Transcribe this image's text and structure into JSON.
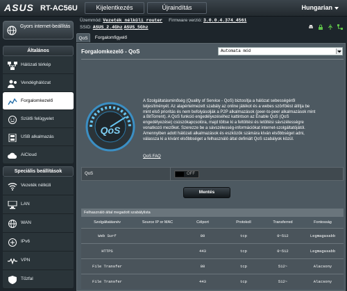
{
  "header": {
    "logo": "ASUS",
    "model": "RT-AC56U",
    "logout_label": "Kijelentkezés",
    "reboot_label": "Újraindítás",
    "language": "Hungarian"
  },
  "status": {
    "mode_label": "Üzemmód:",
    "mode_value": "Vezeték nélküli router",
    "firmware_label": "Firmware verzió:",
    "firmware_value": "3.0.0.4.374_4561",
    "ssid_label": "SSID:",
    "ssid_24": "ASUS_2.4Ghz",
    "ssid_5": "ASUS_5Ghz"
  },
  "sidebar": {
    "quick_label": "Gyors internet-beállítás",
    "general_title": "Általános",
    "general_items": [
      {
        "label": "Hálózati térkép",
        "icon": "network-map-icon"
      },
      {
        "label": "Vendéghálózat",
        "icon": "guest-network-icon"
      },
      {
        "label": "Forgalomkezelő",
        "icon": "traffic-manager-icon"
      },
      {
        "label": "Szülői felügyelet",
        "icon": "parental-control-icon"
      },
      {
        "label": "USB alkalmazás",
        "icon": "usb-icon"
      },
      {
        "label": "AiCloud",
        "icon": "cloud-icon"
      }
    ],
    "advanced_title": "Speciális beállítások",
    "advanced_items": [
      {
        "label": "Vezeték nélküli",
        "icon": "wireless-icon"
      },
      {
        "label": "LAN",
        "icon": "lan-icon"
      },
      {
        "label": "WAN",
        "icon": "wan-icon"
      },
      {
        "label": "IPv6",
        "icon": "ipv6-icon"
      },
      {
        "label": "VPN",
        "icon": "vpn-icon"
      },
      {
        "label": "Tűzfal",
        "icon": "firewall-icon"
      }
    ]
  },
  "tabs": [
    "QoS",
    "Forgalomfigyelő"
  ],
  "panel": {
    "title": "Forgalomkezelő - QoS",
    "mode_select": "Automata mód",
    "description": "A Szolgáltatásminőség (Quality of Service - QoS) biztosítja a hálózat sebességéről teljesítményét. Az alapértelmezett szabály az online játékot és a webes szörfölést állítja be mint első prioritás és nem befolyásolják a P2P alkalmazások (peer-to-peer alkalmazások mint a BitTorrent). A QoS funkció engedélyezéséhez kattintson az Enable QoS (QoS engedélyezése) csúszókapcsolóra, majd töltse ki a feltöltési és letöltési sávszélességre vonatkozó mezőket. Szerezze be a sávszélesség-információkat internet-szolgáltatójától.\nAmennyiben adott hálózati alkalmazások és eszközök számára kíván elsőbbséget adni, válassza ki a kívánt elsőbbséget a felhasználó által definiált QoS szabályok közül.",
    "faq_link": "QoS FAQ",
    "qos_label": "QoS",
    "qos_toggle": "OFF",
    "save_label": "Mentés"
  },
  "rules_table": {
    "caption": "Felhasználó által megadott szabálylista",
    "headers": [
      "Szolgáltatásnév",
      "Source IP or MAC",
      "Célport",
      "Protokoll",
      "Transferred",
      "Fontosság"
    ],
    "rows": [
      [
        "Web Surf",
        "",
        "80",
        "tcp",
        "0~512",
        "Legmagasabb"
      ],
      [
        "HTTPS",
        "",
        "443",
        "tcp",
        "0~512",
        "Legmagasabb"
      ],
      [
        "File Transfer",
        "",
        "80",
        "tcp",
        "512~",
        "Alacsony"
      ],
      [
        "File Transfer",
        "",
        "443",
        "tcp",
        "512~",
        "Alacsony"
      ]
    ]
  }
}
